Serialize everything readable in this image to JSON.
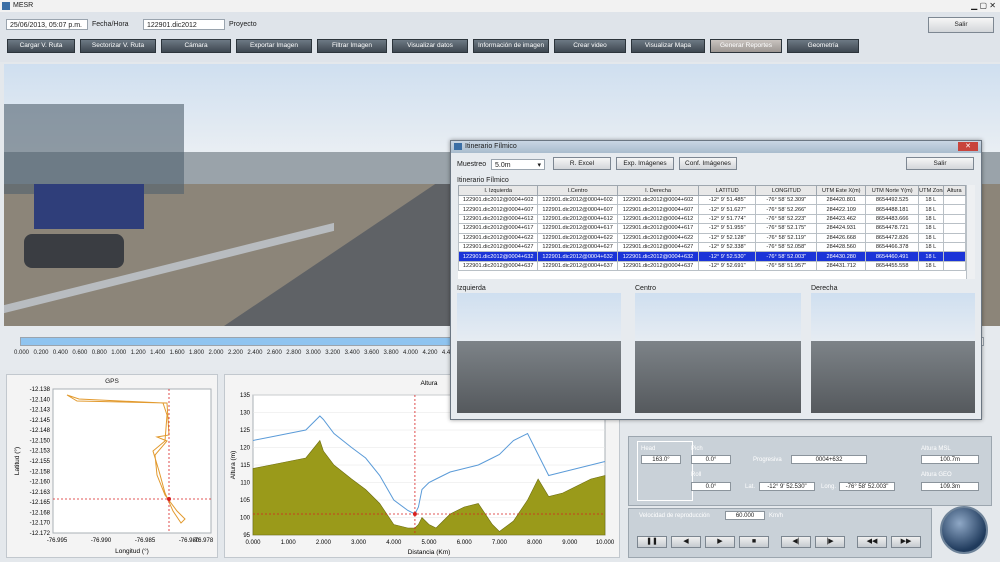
{
  "window": {
    "title": "MESR"
  },
  "topbar": {
    "datetime": "25/06/2013, 05:07 p.m.",
    "datetime_label": "Fecha/Hora",
    "project": "122901.dic2012",
    "project_label": "Proyecto",
    "exit_label": "Salir"
  },
  "toolbar": {
    "items": [
      "Cargar V. Ruta",
      "Sectorizar V. Ruta",
      "Cámara",
      "Exportar Imagen",
      "Filtrar Imagen",
      "Visualizar datos",
      "Información de imagen",
      "Crear video",
      "Visualizar Mapa",
      "Generar Reportes",
      "Geometría"
    ],
    "active_index": 9
  },
  "slider": {
    "ticks": [
      "0.000",
      "0.200",
      "0.400",
      "0.600",
      "0.800",
      "1.000",
      "1.200",
      "1.400",
      "1.600",
      "1.800",
      "2.000",
      "2.200",
      "2.400",
      "2.600",
      "2.800",
      "3.000",
      "3.200",
      "3.400",
      "3.600",
      "3.800",
      "4.000",
      "4.200",
      "4.400"
    ],
    "position": 0.463
  },
  "gps_chart": {
    "title": "GPS",
    "xlabel": "Longitud (°)",
    "ylabel": "Latitud (°)",
    "yticks": [
      "-12.138",
      "-12.140",
      "-12.143",
      "-12.145",
      "-12.148",
      "-12.150",
      "-12.153",
      "-12.155",
      "-12.158",
      "-12.160",
      "-12.163",
      "-12.165",
      "-12.168",
      "-12.170",
      "-12.172"
    ],
    "xticks": [
      "-76.995",
      "-76.990",
      "-76.985",
      "-76.980",
      "-76.978"
    ]
  },
  "chart_data": {
    "type": "area",
    "title": "Altura",
    "xlabel": "Distancia (Km)",
    "ylabel": "Altura (m)",
    "xlim": [
      0,
      10
    ],
    "ylim": [
      95,
      135
    ],
    "xticks": [
      "0.000",
      "1.000",
      "2.000",
      "3.000",
      "4.000",
      "5.000",
      "6.000",
      "7.000",
      "8.000",
      "9.000",
      "10.000"
    ],
    "yticks": [
      "95",
      "100",
      "105",
      "110",
      "115",
      "120",
      "125",
      "130",
      "135"
    ],
    "x": [
      0,
      0.5,
      1.0,
      1.5,
      1.9,
      2.0,
      2.3,
      2.8,
      3.2,
      3.6,
      4.0,
      4.4,
      4.6,
      4.7,
      4.8,
      5.0,
      5.2,
      5.4,
      5.6,
      6.0,
      6.4,
      6.8,
      7.0,
      7.4,
      7.8,
      8.1,
      8.4,
      8.8,
      9.2,
      9.6,
      10.0
    ],
    "series": [
      {
        "values": [
          122,
          123,
          124,
          125,
          129,
          128,
          124,
          120,
          117,
          112,
          105,
          102,
          101,
          103,
          108,
          110,
          111,
          112,
          113,
          114,
          115,
          117,
          118,
          122,
          124,
          118,
          112,
          113,
          114,
          115,
          116
        ]
      },
      {
        "values": [
          114,
          115,
          116,
          117,
          122,
          119,
          115,
          111,
          108,
          104,
          98,
          97,
          97,
          98,
          100,
          98,
          97,
          99,
          101,
          103,
          104,
          98,
          96,
          99,
          105,
          111,
          106,
          107,
          109,
          111,
          112
        ]
      }
    ],
    "cursor": {
      "x": 4.6,
      "y": 101
    }
  },
  "dialog": {
    "title": "Itinerario Fílmico",
    "sample_label": "Muestreo",
    "sample_value": "5.0m",
    "buttons": [
      "R. Excel",
      "Exp. Imágenes",
      "Conf. Imágenes"
    ],
    "exit_label": "Salir",
    "table_label": "Itinerario Fílmico",
    "columns": [
      "I. Izquierda",
      "I.Centro",
      "I. Derecha",
      "LATITUD",
      "LONGITUD",
      "UTM Este X(m)",
      "UTM Norte Y(m)",
      "UTM Zona",
      "Altura"
    ],
    "rows": [
      [
        "122901.dic2012@0004+602",
        "122901.dic2012@0004+602",
        "122901.dic2012@0004+602",
        "-12° 9' 51.485\"",
        "-76° 58' 52.309\"",
        "284420.801",
        "8654492.525",
        "18 L",
        ""
      ],
      [
        "122901.dic2012@0004+607",
        "122901.dic2012@0004+607",
        "122901.dic2012@0004+607",
        "-12° 9' 51.627\"",
        "-76° 58' 52.266\"",
        "284422.109",
        "8654488.181",
        "18 L",
        ""
      ],
      [
        "122901.dic2012@0004+612",
        "122901.dic2012@0004+612",
        "122901.dic2012@0004+612",
        "-12° 9' 51.774\"",
        "-76° 58' 52.223\"",
        "284423.462",
        "8654483.666",
        "18 L",
        ""
      ],
      [
        "122901.dic2012@0004+617",
        "122901.dic2012@0004+617",
        "122901.dic2012@0004+617",
        "-12° 9' 51.955\"",
        "-76° 58' 52.175\"",
        "284424.931",
        "8654478.721",
        "18 L",
        ""
      ],
      [
        "122901.dic2012@0004+622",
        "122901.dic2012@0004+622",
        "122901.dic2012@0004+622",
        "-12° 9' 52.128\"",
        "-76° 58' 52.119\"",
        "284426.668",
        "8654472.826",
        "18 L",
        ""
      ],
      [
        "122901.dic2012@0004+627",
        "122901.dic2012@0004+627",
        "122901.dic2012@0004+627",
        "-12° 9' 52.338\"",
        "-76° 58' 52.058\"",
        "284428.560",
        "8654466.378",
        "18 L",
        ""
      ],
      [
        "122901.dic2012@0004+632",
        "122901.dic2012@0004+632",
        "122901.dic2012@0004+632",
        "-12° 9' 52.530\"",
        "-76° 58' 52.003\"",
        "284430.280",
        "8654460.491",
        "18 L",
        ""
      ],
      [
        "122901.dic2012@0004+637",
        "122901.dic2012@0004+637",
        "122901.dic2012@0004+637",
        "-12° 9' 52.691\"",
        "-76° 58' 51.957\"",
        "284431.712",
        "8654455.558",
        "18 L",
        ""
      ]
    ],
    "selected_row": 6,
    "cams": [
      "Izquierda",
      "Centro",
      "Derecha"
    ]
  },
  "info": {
    "head_label": "Head",
    "head_value": "163.0°",
    "pitch_label": "Pich",
    "pitch_value": "0.0°",
    "roll_label": "Roll",
    "roll_value": "0.0°",
    "prog_label": "Progresiva",
    "prog_value": "0004+632",
    "lat_label": "Lat.",
    "lat_value": "-12° 9' 52.530\"",
    "long_label": "Long.",
    "long_value": "-76° 58' 52.003\"",
    "msl_label": "Altura MSL",
    "msl_value": "100.7m",
    "geo_label": "Altura GEO",
    "geo_value": "109.3m"
  },
  "playback": {
    "speed_label": "Velocidad de reproducción",
    "speed_value": "60.000",
    "speed_unit": "Km/h"
  },
  "colors": {
    "accent": "#1b34d8",
    "area": "#9a9a1a",
    "line": "#5b9bd8",
    "gps": "#e29a2e",
    "cursor": "#d82020"
  }
}
